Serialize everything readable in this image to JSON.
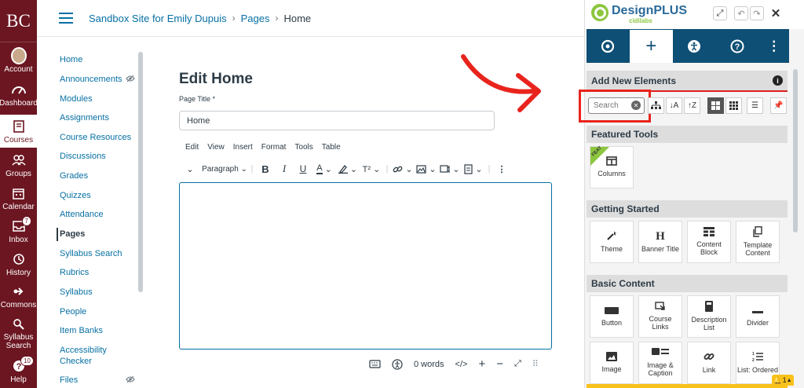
{
  "global_nav": {
    "logo": "BC",
    "items": [
      {
        "label": "Account",
        "icon": "avatar"
      },
      {
        "label": "Dashboard",
        "icon": "dashboard-icon"
      },
      {
        "label": "Courses",
        "icon": "courses-icon"
      },
      {
        "label": "Groups",
        "icon": "groups-icon"
      },
      {
        "label": "Calendar",
        "icon": "calendar-icon"
      },
      {
        "label": "Inbox",
        "icon": "inbox-icon",
        "badge": "7"
      },
      {
        "label": "History",
        "icon": "history-icon"
      },
      {
        "label": "Commons",
        "icon": "commons-icon"
      },
      {
        "label": "Syllabus Search",
        "icon": "syllabus-search-icon"
      },
      {
        "label": "Help",
        "icon": "help-icon",
        "badge": "10"
      }
    ]
  },
  "breadcrumbs": [
    "Sandbox Site for Emily Dupuis",
    "Pages",
    "Home"
  ],
  "course_nav": [
    "Home",
    "Announcements",
    "Modules",
    "Assignments",
    "Course Resources",
    "Discussions",
    "Grades",
    "Quizzes",
    "Attendance",
    "Pages",
    "Syllabus Search",
    "Rubrics",
    "Syllabus",
    "People",
    "Item Banks",
    "Accessibility Checker",
    "Files"
  ],
  "editor": {
    "heading": "Edit Home",
    "page_title_label": "Page Title",
    "required_mark": "*",
    "page_title_value": "Home",
    "menu": [
      "Edit",
      "View",
      "Insert",
      "Format",
      "Tools",
      "Table"
    ],
    "paragraph_label": "Paragraph",
    "word_count": "0 words"
  },
  "designplus": {
    "brand": "DesignPLUS",
    "sub_brand": "cidilabs",
    "add_new_heading": "Add New Elements",
    "search_placeholder": "Search",
    "featured_heading": "Featured Tools",
    "feat_badge": "FEAT",
    "featured_tiles": [
      "Columns"
    ],
    "getting_started_heading": "Getting Started",
    "getting_started_tiles": [
      "Theme",
      "Banner Title",
      "Content Block",
      "Template Content"
    ],
    "basic_heading": "Basic Content",
    "basic_tiles": [
      "Button",
      "Course Links",
      "Description List",
      "Divider",
      "Image",
      "Image & Caption",
      "Link",
      "List: Ordered"
    ],
    "notification_count": "1"
  },
  "colors": {
    "nav_bg": "#6b1621",
    "link": "#0770a3",
    "panel_tab_bg": "#0e4f75",
    "brand_green": "#8cc63f",
    "highlight_red": "#e8241d"
  }
}
